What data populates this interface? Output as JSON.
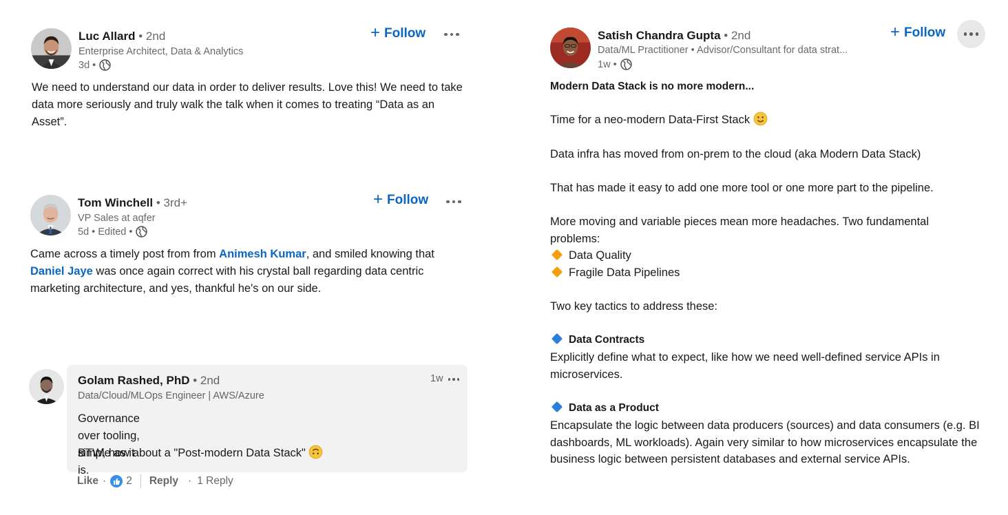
{
  "colors": {
    "accent": "#0a66c2",
    "like_blue": "#378fe9",
    "comment_bg": "#f2f2f2",
    "diamond_orange": "#f59e0b",
    "diamond_blue": "#2b7fd8"
  },
  "post1": {
    "name": "Luc Allard",
    "degree": "• 2nd",
    "headline": "Enterprise Architect, Data & Analytics",
    "time": "3d •",
    "follow_label": "Follow",
    "text": "We need to understand our data in order to deliver results. Love this! We need to take data more seriously and truly walk the talk when it comes to treating “Data as an Asset”."
  },
  "post2": {
    "name": "Tom Winchell",
    "degree": "• 3rd+",
    "headline": "VP Sales at aqfer",
    "time": "5d • Edited •",
    "follow_label": "Follow",
    "text_part1": "Came across a timely post from from ",
    "link1": "Animesh Kumar",
    "text_part2": ", and smiled knowing that ",
    "link2": "Daniel Jaye",
    "text_part3": " was once again correct with his crystal ball regarding data centric marketing architecture, and yes, thankful he's on our side."
  },
  "comment": {
    "name": "Golam Rashed, PhD",
    "degree": "• 2nd",
    "headline": "Data/Cloud/MLOps Engineer | AWS/Azure",
    "time": "1w",
    "line1": "Governance over tooling, simple as it is.",
    "line2": "BTW, how about a \"Post-modern Data Stack\"",
    "like_label": "Like",
    "like_count": "2",
    "reply_label": "Reply",
    "reply_count": "1 Reply"
  },
  "post3": {
    "name": "Satish Chandra Gupta",
    "degree": "• 2nd",
    "headline": "Data/ML Practitioner • Advisor/Consultant for data strat...",
    "time": "1w •",
    "follow_label": "Follow",
    "title": "Modern Data Stack is no more modern...",
    "p1": "Time for a neo-modern Data-First Stack",
    "p2": "Data infra has moved from on-prem to the cloud (aka Modern Data Stack)",
    "p3": "That has made it easy to add one more tool or one more part to the pipeline.",
    "p4": "More moving and variable pieces mean more headaches. Two fundamental problems:",
    "problem1": "Data Quality",
    "problem2": "Fragile Data Pipelines",
    "p5": "Two key tactics to address these:",
    "tactic1_title": "Data Contracts",
    "tactic1_text": "Explicitly define what to expect, like how we need well-defined service APIs in microservices.",
    "tactic2_title": "Data as a Product",
    "tactic2_text": "Encapsulate the logic between data producers (sources) and data consumers (e.g. BI dashboards, ML workloads). Again very similar to how microservices encapsulate the business logic between persistent databases and external service APIs."
  }
}
